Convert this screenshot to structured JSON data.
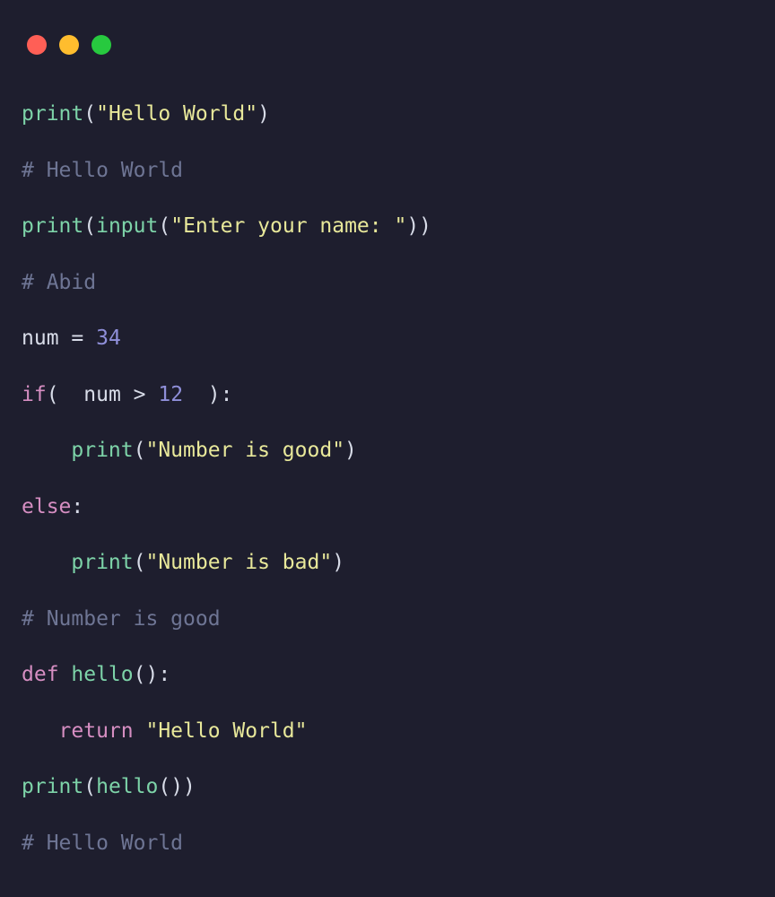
{
  "lines": {
    "l1_print": "print",
    "l1_p1": "(",
    "l1_str": "\"Hello World\"",
    "l1_p2": ")",
    "l2_comment": "# Hello World",
    "l3_print": "print",
    "l3_p1": "(",
    "l3_input": "input",
    "l3_p2": "(",
    "l3_str": "\"Enter your name: \"",
    "l3_p3": "))",
    "l4_comment": "# Abid",
    "l5_var": "num ",
    "l5_eq": "= ",
    "l5_num": "34",
    "l6_if": "if",
    "l6_p1": "(  ",
    "l6_var": "num ",
    "l6_gt": "> ",
    "l6_num": "12",
    "l6_p2": "  )",
    "l6_colon": ":",
    "l7_print": "print",
    "l7_p1": "(",
    "l7_str": "\"Number is good\"",
    "l7_p2": ")",
    "l8_else": "else",
    "l8_colon": ":",
    "l9_print": "print",
    "l9_p1": "(",
    "l9_str": "\"Number is bad\"",
    "l9_p2": ")",
    "l10_comment": "# Number is good",
    "l11_def": "def ",
    "l11_name": "hello",
    "l11_p": "()",
    "l11_colon": ":",
    "l12_return": "return ",
    "l12_str": "\"Hello World\"",
    "l13_print": "print",
    "l13_p1": "(",
    "l13_call": "hello",
    "l13_p2": "())",
    "l14_comment": "# Hello World"
  }
}
